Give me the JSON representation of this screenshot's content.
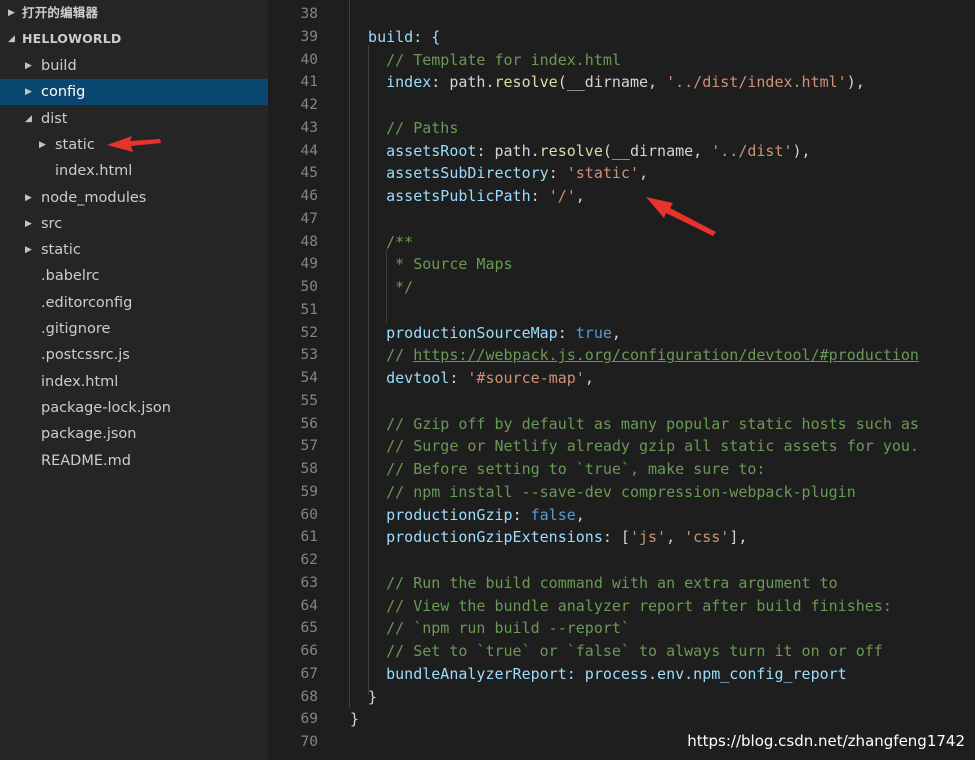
{
  "sidebar": {
    "open_editors": "打开的编辑器",
    "project": "HELLOWORLD",
    "items": [
      {
        "label": "build",
        "type": "folder",
        "state": "collapsed"
      },
      {
        "label": "config",
        "type": "folder",
        "state": "collapsed",
        "selected": true
      },
      {
        "label": "dist",
        "type": "folder",
        "state": "expanded"
      },
      {
        "label": "static",
        "type": "folder",
        "state": "collapsed",
        "indent": 2
      },
      {
        "label": "index.html",
        "type": "file",
        "indent": 2
      },
      {
        "label": "node_modules",
        "type": "folder",
        "state": "collapsed"
      },
      {
        "label": "src",
        "type": "folder",
        "state": "collapsed"
      },
      {
        "label": "static",
        "type": "folder",
        "state": "collapsed"
      },
      {
        "label": ".babelrc",
        "type": "file"
      },
      {
        "label": ".editorconfig",
        "type": "file"
      },
      {
        "label": ".gitignore",
        "type": "file"
      },
      {
        "label": ".postcssrc.js",
        "type": "file"
      },
      {
        "label": "index.html",
        "type": "file"
      },
      {
        "label": "package-lock.json",
        "type": "file"
      },
      {
        "label": "package.json",
        "type": "file"
      },
      {
        "label": "README.md",
        "type": "file"
      }
    ]
  },
  "editor": {
    "line_numbers": [
      "38",
      "39",
      "40",
      "41",
      "42",
      "43",
      "44",
      "45",
      "46",
      "47",
      "48",
      "49",
      "50",
      "51",
      "52",
      "53",
      "54",
      "55",
      "56",
      "57",
      "58",
      "59",
      "60",
      "61",
      "62",
      "63",
      "64",
      "65",
      "66",
      "67",
      "68",
      "69",
      "70"
    ],
    "lines": [
      [],
      [
        {
          "t": "  build: {",
          "c": "kw"
        }
      ],
      [
        {
          "t": "    // Template for index.html",
          "c": "com"
        }
      ],
      [
        {
          "t": "    index",
          "c": "kw"
        },
        {
          "t": ": path.",
          "c": ""
        },
        {
          "t": "resolve",
          "c": "fn"
        },
        {
          "t": "(__dirname, ",
          "c": ""
        },
        {
          "t": "'../dist/index.html'",
          "c": "str"
        },
        {
          "t": "),",
          "c": ""
        }
      ],
      [],
      [
        {
          "t": "    // Paths",
          "c": "com"
        }
      ],
      [
        {
          "t": "    assetsRoot",
          "c": "kw"
        },
        {
          "t": ": path.",
          "c": ""
        },
        {
          "t": "resolve",
          "c": "fn"
        },
        {
          "t": "(__dirname, ",
          "c": ""
        },
        {
          "t": "'../dist'",
          "c": "str"
        },
        {
          "t": "),",
          "c": ""
        }
      ],
      [
        {
          "t": "    assetsSubDirectory",
          "c": "kw"
        },
        {
          "t": ": ",
          "c": ""
        },
        {
          "t": "'static'",
          "c": "str"
        },
        {
          "t": ",",
          "c": ""
        }
      ],
      [
        {
          "t": "    assetsPublicPath",
          "c": "kw"
        },
        {
          "t": ": ",
          "c": ""
        },
        {
          "t": "'/'",
          "c": "str"
        },
        {
          "t": ",",
          "c": ""
        }
      ],
      [],
      [
        {
          "t": "    /**",
          "c": "com"
        }
      ],
      [
        {
          "t": "     * Source Maps",
          "c": "com"
        }
      ],
      [
        {
          "t": "     */",
          "c": "com"
        }
      ],
      [],
      [
        {
          "t": "    productionSourceMap",
          "c": "kw"
        },
        {
          "t": ": ",
          "c": ""
        },
        {
          "t": "true",
          "c": "bool"
        },
        {
          "t": ",",
          "c": ""
        }
      ],
      [
        {
          "t": "    // ",
          "c": "com"
        },
        {
          "t": "https://webpack.js.org/configuration/devtool/#production",
          "c": "link"
        }
      ],
      [
        {
          "t": "    devtool",
          "c": "kw"
        },
        {
          "t": ": ",
          "c": ""
        },
        {
          "t": "'#source-map'",
          "c": "str"
        },
        {
          "t": ",",
          "c": ""
        }
      ],
      [],
      [
        {
          "t": "    // Gzip off by default as many popular static hosts such as",
          "c": "com"
        }
      ],
      [
        {
          "t": "    // Surge or Netlify already gzip all static assets for you.",
          "c": "com"
        }
      ],
      [
        {
          "t": "    // Before setting to `true`, make sure to:",
          "c": "com"
        }
      ],
      [
        {
          "t": "    // npm install --save-dev compression-webpack-plugin",
          "c": "com"
        }
      ],
      [
        {
          "t": "    productionGzip",
          "c": "kw"
        },
        {
          "t": ": ",
          "c": ""
        },
        {
          "t": "false",
          "c": "bool"
        },
        {
          "t": ",",
          "c": ""
        }
      ],
      [
        {
          "t": "    productionGzipExtensions",
          "c": "kw"
        },
        {
          "t": ": [",
          "c": ""
        },
        {
          "t": "'js'",
          "c": "str"
        },
        {
          "t": ", ",
          "c": ""
        },
        {
          "t": "'css'",
          "c": "str"
        },
        {
          "t": "],",
          "c": ""
        }
      ],
      [],
      [
        {
          "t": "    // Run the build command with an extra argument to",
          "c": "com"
        }
      ],
      [
        {
          "t": "    // View the bundle analyzer report after build finishes:",
          "c": "com"
        }
      ],
      [
        {
          "t": "    // `npm run build --report`",
          "c": "com"
        }
      ],
      [
        {
          "t": "    // Set to `true` or `false` to always turn it on or off",
          "c": "com"
        }
      ],
      [
        {
          "t": "    bundleAnalyzerReport",
          "c": "kw"
        },
        {
          "t": ": process.env.npm_config_report",
          "c": "kw"
        }
      ],
      [
        {
          "t": "  }",
          "c": ""
        }
      ],
      [
        {
          "t": "}",
          "c": ""
        }
      ],
      []
    ]
  },
  "watermark": "https://blog.csdn.net/zhangfeng1742",
  "colors": {
    "sidebar_bg": "#252526",
    "editor_bg": "#1e1e1e",
    "selected_bg": "#094771",
    "arrow": "#e8322b"
  }
}
